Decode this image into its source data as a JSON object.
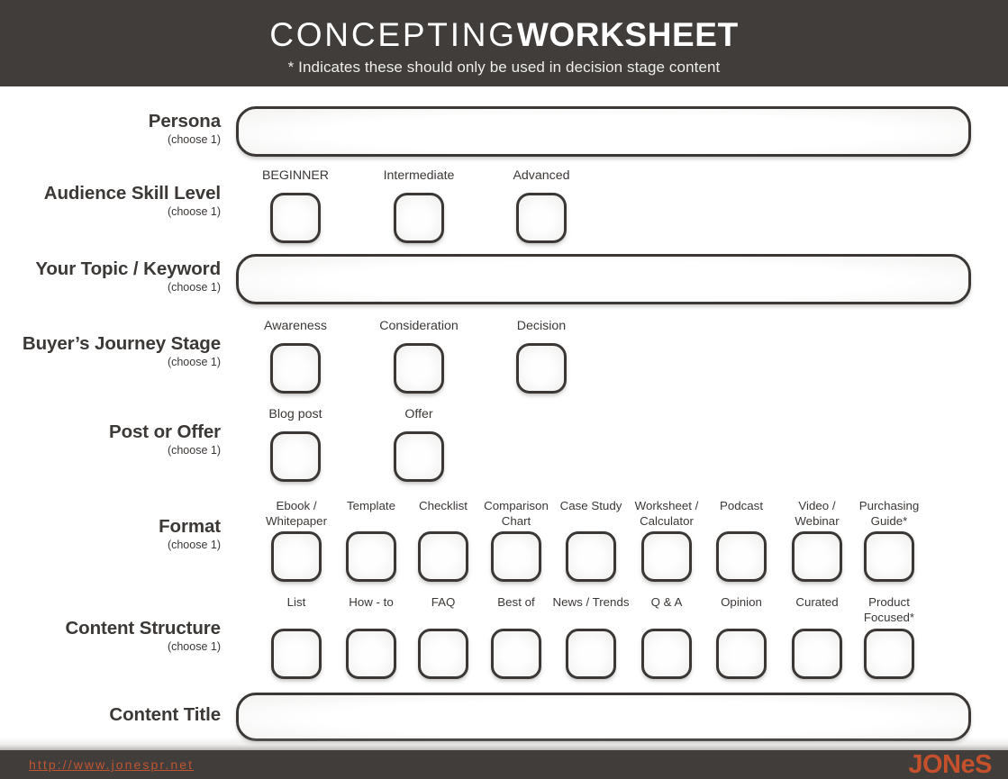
{
  "header": {
    "title_thin": "CONCEPTING",
    "title_bold": "WORKSHEET",
    "subtitle": "* Indicates these should only be used in decision stage content"
  },
  "rows": {
    "persona": {
      "label": "Persona",
      "sublabel": "(choose 1)",
      "field_value": "",
      "field_placeholder": ""
    },
    "audience_skill_level": {
      "label": "Audience Skill Level",
      "sublabel": "(choose 1)",
      "options": [
        "BEGINNER",
        "Intermediate",
        "Advanced"
      ]
    },
    "topic_keyword": {
      "label": "Your Topic / Keyword",
      "sublabel": "(choose 1)",
      "field_value": "",
      "field_placeholder": ""
    },
    "buyers_journey_stage": {
      "label": "Buyer’s Journey Stage",
      "sublabel": "(choose 1)",
      "options": [
        "Awareness",
        "Consideration",
        "Decision"
      ]
    },
    "post_or_offer": {
      "label": "Post or Offer",
      "sublabel": "(choose 1)",
      "options": [
        "Blog post",
        "Offer"
      ]
    },
    "format": {
      "label": "Format",
      "sublabel": "(choose 1)",
      "options": [
        "Ebook /\nWhitepaper",
        "Template",
        "Checklist",
        "Comparison\nChart",
        "Case Study",
        "Worksheet /\nCalculator",
        "Podcast",
        "Video /\nWebinar",
        "Purchasing\nGuide*"
      ]
    },
    "content_structure": {
      "label": "Content Structure",
      "sublabel": "(choose 1)",
      "options": [
        "List",
        "How - to",
        "FAQ",
        "Best of",
        "News / Trends",
        "Q & A",
        "Opinion",
        "Curated",
        "Product\nFocused*"
      ]
    },
    "content_title": {
      "label": "Content Title",
      "sublabel": "",
      "field_value": "",
      "field_placeholder": ""
    }
  },
  "footer": {
    "url": "http://www.jonespr.net",
    "logo_part1": "JON",
    "logo_part2": "e",
    "logo_part3": "S"
  },
  "colors": {
    "header_bg": "#403d3a",
    "accent_orange": "#c4512b",
    "ink": "#3b3836",
    "page_bg": "#ffffff"
  }
}
